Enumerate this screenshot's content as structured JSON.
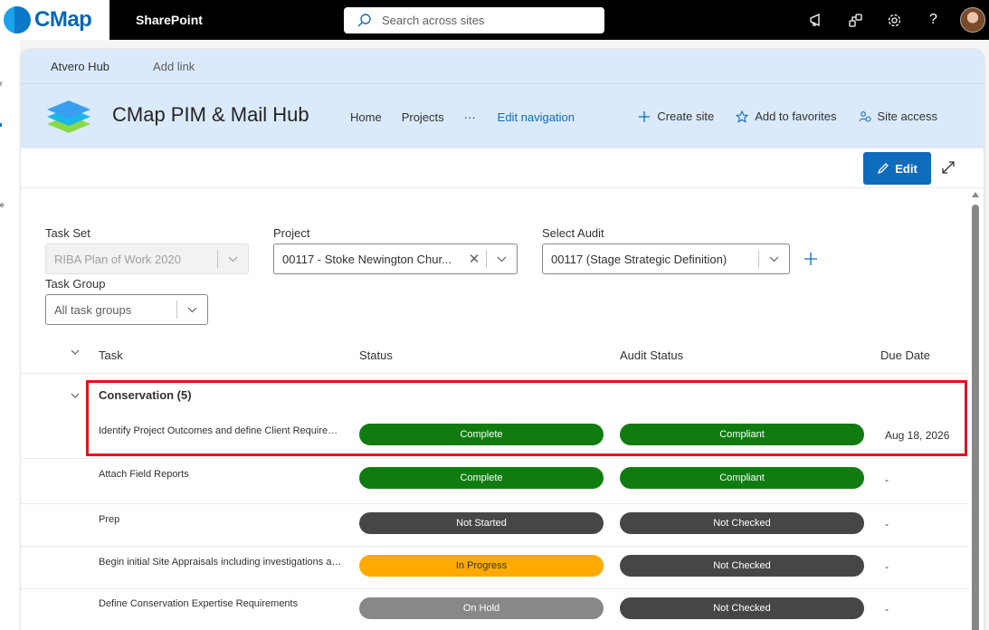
{
  "suitebar": {
    "brand": "CMap",
    "app_name": "SharePoint",
    "search_placeholder": "Search across sites",
    "icons": [
      "megaphone-icon",
      "share-icon",
      "gear-icon",
      "help-icon"
    ],
    "help_glyph": "?"
  },
  "left_edge": {
    "chars": [
      "r",
      "e"
    ]
  },
  "hubnav": {
    "items": [
      "Atvero Hub",
      "Add link"
    ]
  },
  "site": {
    "title": "CMap PIM & Mail Hub",
    "nav": [
      "Home",
      "Projects",
      "···",
      "Edit navigation"
    ],
    "actions": [
      "Create site",
      "Add to favorites",
      "Site access"
    ]
  },
  "cmdbar": {
    "edit_label": "Edit"
  },
  "filters": {
    "task_set": {
      "label": "Task Set",
      "value": "RIBA Plan of Work 2020"
    },
    "project": {
      "label": "Project",
      "value": "00117 - Stoke Newington Chur..."
    },
    "select_audit": {
      "label": "Select Audit",
      "value": "00117 (Stage Strategic Definition)"
    },
    "task_group": {
      "label": "Task Group",
      "value": "All task groups"
    }
  },
  "table": {
    "columns": [
      "Task",
      "Status",
      "Audit Status",
      "Due Date"
    ],
    "group": {
      "title": "Conservation (5)"
    },
    "rows": [
      {
        "task": "Identify Project Outcomes and define Client Requireme...",
        "status": "Complete",
        "audit": "Compliant",
        "due": "Aug 18, 2026"
      },
      {
        "task": "Attach Field Reports",
        "status": "Complete",
        "audit": "Compliant",
        "due": "-"
      },
      {
        "task": "Prep",
        "status": "Not Started",
        "audit": "Not Checked",
        "due": "-"
      },
      {
        "task": "Begin initial Site Appraisals including investigations an...",
        "status": "In Progress",
        "audit": "Not Checked",
        "due": "-"
      },
      {
        "task": "Define Conservation Expertise Requirements",
        "status": "On Hold",
        "audit": "Not Checked",
        "due": "-"
      }
    ]
  },
  "colors": {
    "complete": "#107c10",
    "compliant": "#107c10",
    "not_started": "#484644",
    "not_checked": "#484644",
    "in_progress": "#ffaa00",
    "on_hold": "#8a8886",
    "accent": "#0f6cbd",
    "highlight": "#e0141e"
  }
}
